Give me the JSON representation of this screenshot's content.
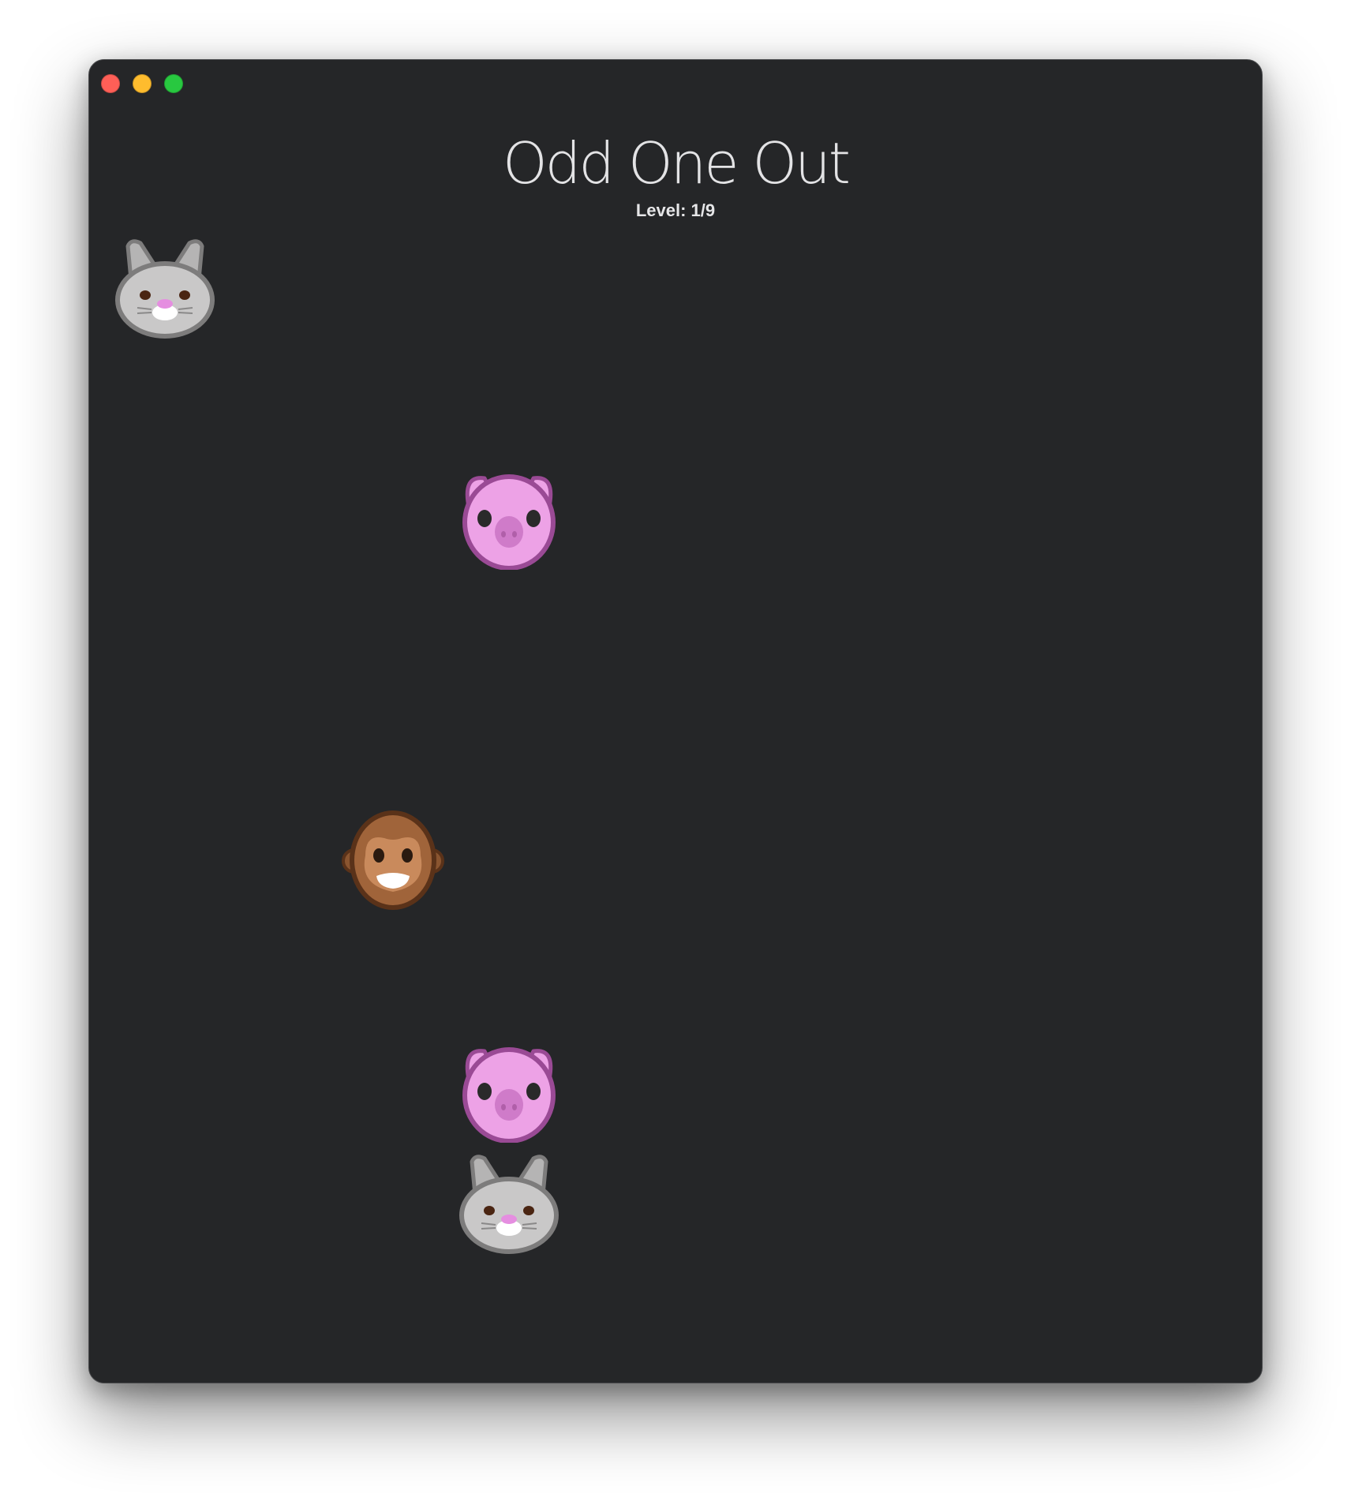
{
  "window": {
    "traffic_lights": [
      {
        "name": "close-button",
        "color": "#fe5f57"
      },
      {
        "name": "minimize-button",
        "color": "#febc2e"
      },
      {
        "name": "zoom-button",
        "color": "#28c840"
      }
    ]
  },
  "game": {
    "title": "Odd One Out",
    "level_text": "Level: 1/9"
  },
  "animals": [
    {
      "kind": "rabbit",
      "icon": "rabbit-face-icon"
    },
    {
      "kind": "pig",
      "icon": "pig-face-icon"
    },
    {
      "kind": "monkey",
      "icon": "monkey-face-icon"
    },
    {
      "kind": "pig",
      "icon": "pig-face-icon"
    },
    {
      "kind": "rabbit",
      "icon": "rabbit-face-icon"
    }
  ],
  "colors": {
    "background": "#252628",
    "text": "#e3e3e5",
    "rabbit_fur": "#c9c8c8",
    "pig_skin": "#eda2e6",
    "monkey_fur": "#a0643a"
  }
}
